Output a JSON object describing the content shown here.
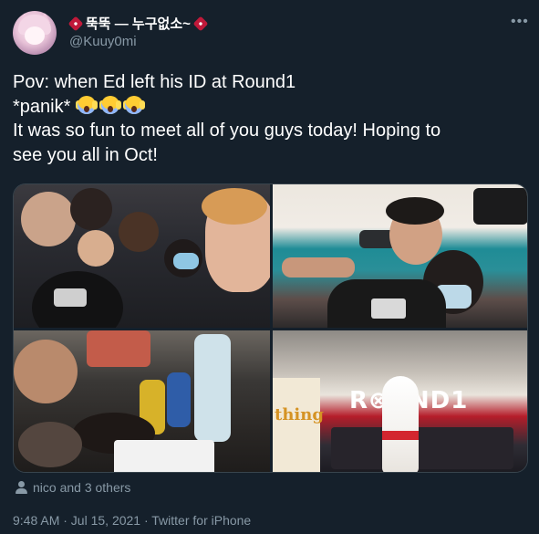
{
  "tweet": {
    "display_name": "뚝뚝 — 누구없소~",
    "handle": "@Kuuy0mi",
    "text_lines": [
      "Pov: when Ed left his ID at Round1",
      "*panik*",
      "It was so fun to meet all of you guys today! Hoping to",
      "see you all in Oct!"
    ],
    "emoji_name": "face-screaming-in-fear-icon",
    "emoji_count": 3,
    "photos": [
      {
        "name": "group-selfie-photo",
        "alt_sign": ""
      },
      {
        "name": "round1-selfie-photo",
        "alt_sign": ""
      },
      {
        "name": "dinner-table-photo",
        "alt_sign": ""
      },
      {
        "name": "round1-entrance-photo",
        "sign_text": "R⊗UND1",
        "store_text": "thing"
      }
    ],
    "likes_text": "nico and 3 others",
    "timestamp": "9:48 AM · Jul 15, 2021 · Twitter for iPhone"
  },
  "colors": {
    "background": "#15202b",
    "secondary_text": "#8899a6",
    "border": "#38444d"
  }
}
